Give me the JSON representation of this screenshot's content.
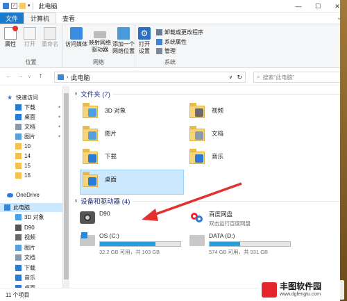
{
  "window": {
    "title": "此电脑",
    "minimize": "—",
    "maximize": "☐",
    "close": "✕"
  },
  "tabs": {
    "file": "文件",
    "computer": "计算机",
    "view": "查看"
  },
  "ribbon": {
    "location": {
      "label": "位置",
      "properties": "属性",
      "open": "打开",
      "rename": "重命名"
    },
    "network": {
      "label": "网络",
      "media": "访问媒体",
      "map_drive_1": "映射网络",
      "map_drive_2": "驱动器",
      "add_loc_1": "添加一个",
      "add_loc_2": "网络位置"
    },
    "system": {
      "label": "系统",
      "open_settings_1": "打开",
      "open_settings_2": "设置",
      "uninstall": "卸载或更改程序",
      "sys_props": "系统属性",
      "manage": "管理"
    }
  },
  "address": {
    "path": "此电脑",
    "search_placeholder": "搜索\"此电脑\""
  },
  "nav": {
    "quick_access": "快速访问",
    "items": [
      {
        "label": "下载",
        "icon": "download-icon",
        "pinned": true
      },
      {
        "label": "桌面",
        "icon": "desktop-icon",
        "pinned": true
      },
      {
        "label": "文档",
        "icon": "document-icon",
        "pinned": true
      },
      {
        "label": "图片",
        "icon": "picture-icon",
        "pinned": true
      },
      {
        "label": "10",
        "icon": "folder-icon"
      },
      {
        "label": "14",
        "icon": "folder-icon"
      },
      {
        "label": "15",
        "icon": "folder-icon"
      },
      {
        "label": "16",
        "icon": "folder-icon"
      }
    ],
    "onedrive": "OneDrive",
    "this_pc": "此电脑",
    "pc_items": [
      {
        "label": "3D 对象",
        "icon": "3d-objects-icon"
      },
      {
        "label": "D90",
        "icon": "camera-icon"
      },
      {
        "label": "视频",
        "icon": "video-icon"
      },
      {
        "label": "图片",
        "icon": "picture-icon"
      },
      {
        "label": "文档",
        "icon": "document-icon"
      },
      {
        "label": "下载",
        "icon": "download-icon"
      },
      {
        "label": "音乐",
        "icon": "music-icon"
      },
      {
        "label": "桌面",
        "icon": "desktop-icon"
      }
    ]
  },
  "main": {
    "folders_header": "文件夹 (7)",
    "folders": [
      {
        "label": "3D 对象",
        "icon": "3d-objects-icon"
      },
      {
        "label": "视频",
        "icon": "video-icon"
      },
      {
        "label": "图片",
        "icon": "picture-icon"
      },
      {
        "label": "文档",
        "icon": "document-icon"
      },
      {
        "label": "下载",
        "icon": "download-icon"
      },
      {
        "label": "音乐",
        "icon": "music-icon"
      },
      {
        "label": "桌面",
        "icon": "desktop-icon"
      }
    ],
    "devices_header": "设备和驱动器 (4)",
    "devices": {
      "camera": "D90",
      "baidu": "百度网盘",
      "baidu_sub": "双击运行百度网盘",
      "os_label": "OS (C:)",
      "os_free": "32.2 GB 可用，共 103 GB",
      "os_used": 0.69,
      "data_label": "DATA (D:)",
      "data_free": "574 GB 可用，共 931 GB",
      "data_used": 0.38
    }
  },
  "status": {
    "count": "11 个项目"
  },
  "colors": {
    "accent": "#1979ca",
    "selection": "#cce8ff",
    "drive_fill": "#26a0da",
    "arrow": "#e2312f"
  },
  "watermark": {
    "title": "丰图软件园",
    "url": "www.dgfengtu.com"
  }
}
